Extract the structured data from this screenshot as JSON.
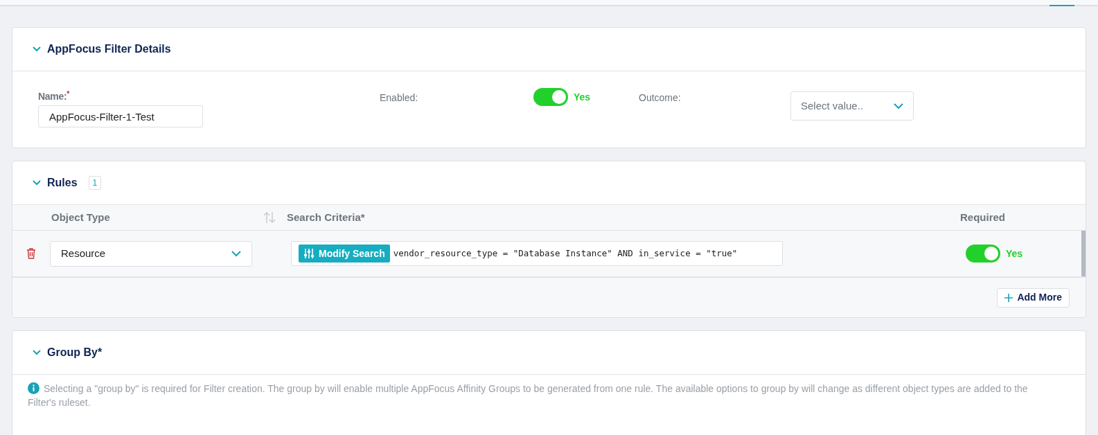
{
  "details": {
    "title": "AppFocus Filter Details",
    "expanded": true,
    "name_field": {
      "label": "Name:",
      "required_mark": "*",
      "value": "AppFocus-Filter-1-Test"
    },
    "enabled": {
      "label": "Enabled:",
      "on": true,
      "state_text": "Yes"
    },
    "outcome": {
      "label": "Outcome:",
      "placeholder": "Select value.."
    }
  },
  "rules": {
    "title": "Rules",
    "expanded": true,
    "count": "1",
    "columns": [
      "Object Type",
      "Search Criteria*",
      "Required"
    ],
    "rows": [
      {
        "object_type": "Resource",
        "button": "Modify Search",
        "criteria": "vendor_resource_type = \"Database Instance\" AND in_service = \"true\"",
        "required": {
          "on": true,
          "state_text": "Yes"
        }
      }
    ],
    "add_button": "Add More"
  },
  "group_by": {
    "title": "Group By*",
    "expanded": true,
    "info": "Selecting a \"group by\" is required for Filter creation. The group by will enable multiple AppFocus Affinity Groups to be generated from one rule. The available options to group by will change as different object types are added to the Filter's ruleset."
  }
}
